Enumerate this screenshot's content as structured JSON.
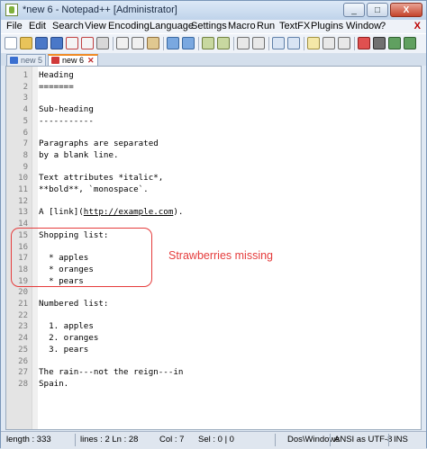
{
  "window": {
    "title": "*new 6 - Notepad++ [Administrator]",
    "minimize_label": "_",
    "maximize_label": "□",
    "close_label": "X"
  },
  "menu": {
    "items": [
      "File",
      "Edit",
      "Search",
      "View",
      "Encoding",
      "Language",
      "Settings",
      "Macro",
      "Run",
      "TextFX",
      "Plugins",
      "Window",
      "?"
    ],
    "close_label": "X"
  },
  "tabs": [
    {
      "label": "new 5",
      "close": "",
      "active": false
    },
    {
      "label": "new 6",
      "close": "✕",
      "active": true
    }
  ],
  "editor": {
    "lines": [
      {
        "n": "1",
        "text": "Heading"
      },
      {
        "n": "2",
        "text": "======="
      },
      {
        "n": "3",
        "text": ""
      },
      {
        "n": "4",
        "text": "Sub-heading"
      },
      {
        "n": "5",
        "text": "-----------"
      },
      {
        "n": "6",
        "text": ""
      },
      {
        "n": "7",
        "text": "Paragraphs are separated"
      },
      {
        "n": "8",
        "text": "by a blank line."
      },
      {
        "n": "9",
        "text": ""
      },
      {
        "n": "10",
        "text": "Text attributes *italic*,"
      },
      {
        "n": "11",
        "text": "**bold**, `monospace`."
      },
      {
        "n": "12",
        "text": ""
      },
      {
        "n": "13",
        "text": "A [link](http://example.com)."
      },
      {
        "n": "14",
        "text": ""
      },
      {
        "n": "15",
        "text": "Shopping list:"
      },
      {
        "n": "16",
        "text": ""
      },
      {
        "n": "17",
        "text": "  * apples"
      },
      {
        "n": "18",
        "text": "  * oranges"
      },
      {
        "n": "19",
        "text": "  * pears"
      },
      {
        "n": "20",
        "text": ""
      },
      {
        "n": "21",
        "text": "Numbered list:"
      },
      {
        "n": "22",
        "text": ""
      },
      {
        "n": "23",
        "text": "  1. apples"
      },
      {
        "n": "24",
        "text": "  2. oranges"
      },
      {
        "n": "25",
        "text": "  3. pears"
      },
      {
        "n": "26",
        "text": ""
      },
      {
        "n": "27",
        "text": "The rain---not the reign---in"
      },
      {
        "n": "28",
        "text": "Spain."
      }
    ],
    "link_text": "http://example.com"
  },
  "annotation": {
    "text": "Strawberries missing",
    "color": "#e53c3c"
  },
  "status": {
    "length": "length : 333",
    "lines": "lines : 2 Ln : 28",
    "col": "Col : 7",
    "sel": "Sel : 0 | 0",
    "eol": "Dos\\Windows",
    "encoding": "ANSI as UTF-8",
    "mode": "INS"
  },
  "colors": {
    "accent_tab": "#f08a24",
    "annotation": "#e53c3c"
  }
}
